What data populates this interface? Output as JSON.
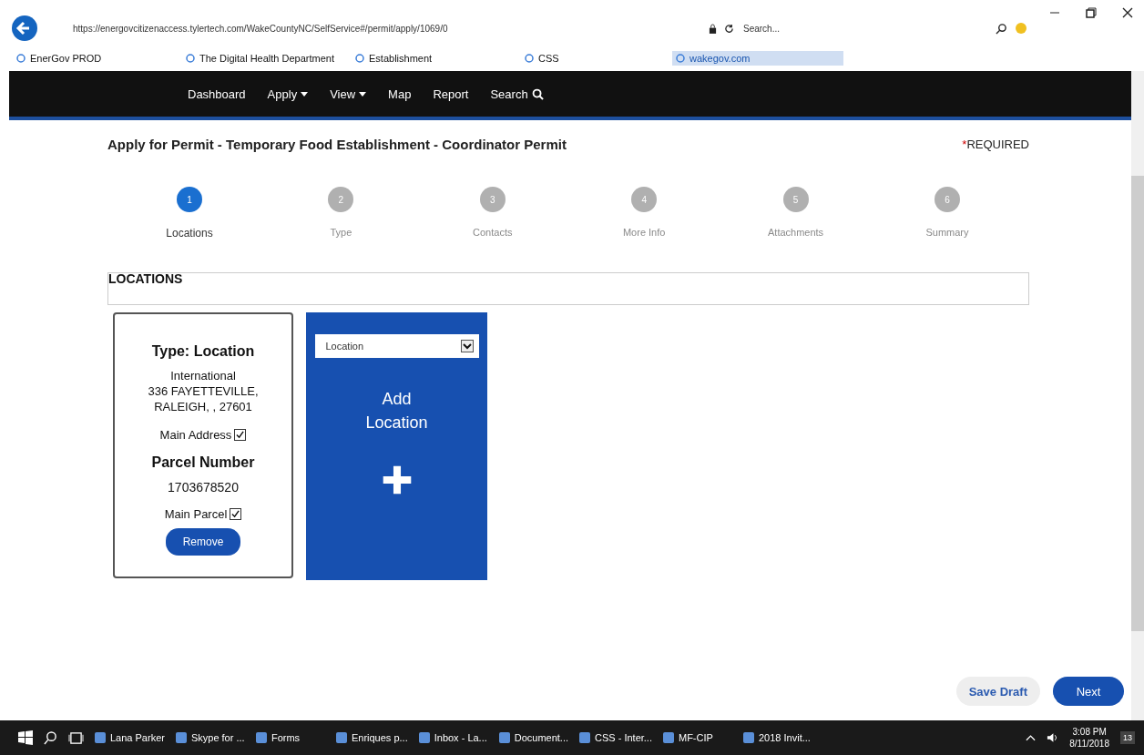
{
  "browser": {
    "url": "https://energovcitizenaccess.tylertech.com/WakeCountyNC/SelfService#/permit/apply/1069/0",
    "search_placeholder": "Search...",
    "favorites": [
      {
        "label": "EnerGov PROD",
        "selected": false
      },
      {
        "label": "The Digital Health Department",
        "selected": false
      },
      {
        "label": "Establishment",
        "selected": false
      },
      {
        "label": "CSS",
        "selected": false
      },
      {
        "label": "wakegov.com",
        "selected": true
      }
    ]
  },
  "nav": [
    {
      "label": "Dashboard",
      "dropdown": false,
      "kind": "link"
    },
    {
      "label": "Apply",
      "dropdown": true,
      "kind": "link"
    },
    {
      "label": "View",
      "dropdown": true,
      "kind": "link"
    },
    {
      "label": "Map",
      "dropdown": false,
      "kind": "link"
    },
    {
      "label": "Report",
      "dropdown": false,
      "kind": "link"
    },
    {
      "label": "Search",
      "dropdown": false,
      "kind": "search"
    }
  ],
  "page_title": "Apply for Permit - Temporary Food Establishment - Coordinator Permit",
  "required_mark": "*",
  "required_label": "REQUIRED",
  "steps": [
    {
      "number": "1",
      "label": "Locations",
      "selected": true
    },
    {
      "number": "2",
      "label": "Type",
      "selected": false
    },
    {
      "number": "3",
      "label": "Contacts",
      "selected": false
    },
    {
      "number": "4",
      "label": "More Info",
      "selected": false
    },
    {
      "number": "5",
      "label": "Attachments",
      "selected": false
    },
    {
      "number": "6",
      "label": "Summary",
      "selected": false
    }
  ],
  "section_title": "LOCATIONS",
  "location_card": {
    "type_heading": "Type: Location",
    "address_lines": [
      "International",
      "336 FAYETTEVILLE,",
      "RALEIGH, , 27601"
    ],
    "main_address_label": "Main Address",
    "main_address_checked": true,
    "parcel_heading": "Parcel Number",
    "parcel_number": "1703678520",
    "main_parcel_label": "Main Parcel",
    "main_parcel_checked": true,
    "remove_button": "Remove"
  },
  "add_card": {
    "select_value": "Location",
    "title_lines": [
      "Add",
      "Location"
    ]
  },
  "buttons": [
    {
      "label": "Save Draft",
      "kind": "secondary"
    },
    {
      "label": "Next",
      "kind": "primary"
    }
  ],
  "taskbar": {
    "apps": [
      {
        "label": "Lana Parker"
      },
      {
        "label": "Skype for ..."
      },
      {
        "label": "Forms"
      },
      {
        "label": "Enriques p..."
      },
      {
        "label": "Inbox - La..."
      },
      {
        "label": "Document..."
      },
      {
        "label": "CSS - Inter..."
      },
      {
        "label": "MF-CIP"
      },
      {
        "label": "2018 Invit..."
      }
    ],
    "time": "3:08 PM",
    "date": "8/11/2018",
    "notifications": "13"
  }
}
